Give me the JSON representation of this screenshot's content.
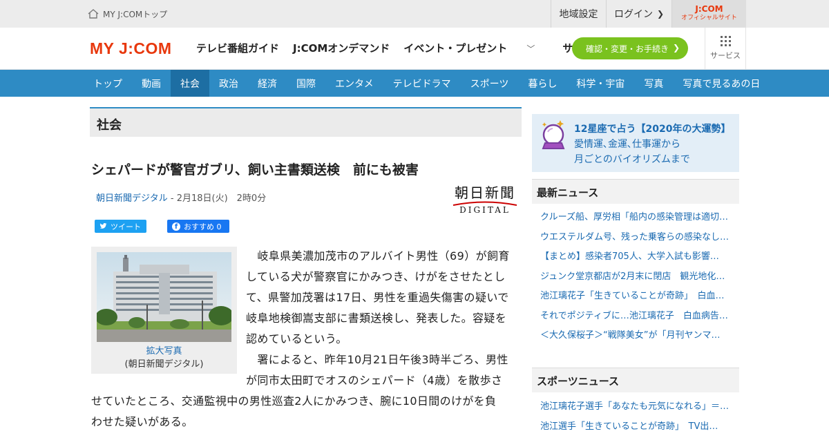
{
  "topbar": {
    "home_label": "MY J:COMトップ",
    "region_label": "地域設定",
    "login_label": "ログイン",
    "official_brand": "J:COM",
    "official_label": "オフィシャルサイト"
  },
  "header": {
    "logo": "MY J:COM",
    "nav": [
      "テレビ番組ガイド",
      "J:COMオンデマンド",
      "イベント・プレゼント",
      "サポート"
    ],
    "cta_label": "確認・変更・お手続き",
    "services_label": "サービス"
  },
  "categories": [
    {
      "label": "トップ",
      "active": false
    },
    {
      "label": "動画",
      "active": false
    },
    {
      "label": "社会",
      "active": true
    },
    {
      "label": "政治",
      "active": false
    },
    {
      "label": "経済",
      "active": false
    },
    {
      "label": "国際",
      "active": false
    },
    {
      "label": "エンタメ",
      "active": false
    },
    {
      "label": "テレビドラマ",
      "active": false
    },
    {
      "label": "スポーツ",
      "active": false
    },
    {
      "label": "暮らし",
      "active": false
    },
    {
      "label": "科学・宇宙",
      "active": false
    },
    {
      "label": "写真",
      "active": false
    },
    {
      "label": "写真で見るあの日",
      "active": false
    }
  ],
  "article": {
    "section": "社会",
    "headline": "シェパードが警官ガブリ、飼い主書類送検　前にも被害",
    "source": "朝日新聞デジタル",
    "date": " - 2月18日(火)　2時0分",
    "publisher_logo_top": "朝日新聞",
    "publisher_logo_bottom": "DIGITAL",
    "tweet_label": "ツイート",
    "fb_label": "おすすめ 0",
    "photo_enlarge": "拡大写真",
    "photo_credit": "(朝日新聞デジタル)",
    "lines": [
      "　岐阜県美濃加茂市のアルバイト男性（69）が飼育",
      "している犬が警察官にかみつき、けがをさせたとし",
      "て、県警加茂署は17日、男性を重過失傷害の疑いで",
      "岐阜地検御嵩支部に書類送検し、発表した。容疑を",
      "認めているという。",
      "　署によると、昨年10月21日午後3時半ごろ、男性",
      "が同市太田町でオスのシェパード（4歳）を散歩さ",
      "せていたところ、交通監視中の男性巡査2人にかみつき、腕に10日間のけがを負",
      "わせた疑いがある。"
    ]
  },
  "sidebar": {
    "promo_title": "12星座で占う【2020年の大運勢】",
    "promo_line2": "愛情運､金運､仕事運から",
    "promo_line3": "月ごとのバイオリズムまで",
    "latest_title": "最新ニュース",
    "latest": [
      "クルーズ船、厚労相「船内の感染管理は適切…",
      "ウエステルダム号、残った乗客らの感染なし…",
      "【まとめ】感染者705人、大学入試も影響…",
      "ジュンク堂京都店が2月末に閉店　観光地化…",
      "池江璃花子「生きていることが奇跡」　白血…",
      "それでポジティブに…池江璃花子　白血病告…",
      "＜大久保桜子＞“戦隊美女”が「月刊ヤンマ…"
    ],
    "sports_title": "スポーツニュース",
    "sports": [
      "池江璃花子選手「あなたも元気になれる」＝…",
      "池江選手「生きていることが奇跡」　TV出…"
    ]
  },
  "colors": {
    "brand": "#e8380d",
    "nav_blue": "#2e8bc4",
    "cta_green": "#7ac21e",
    "link": "#1a6ab1"
  },
  "icons": [
    "home-icon",
    "chevron-right-icon",
    "chevron-down-icon",
    "grid-icon",
    "twitter-icon",
    "facebook-icon",
    "crystal-ball-icon"
  ]
}
